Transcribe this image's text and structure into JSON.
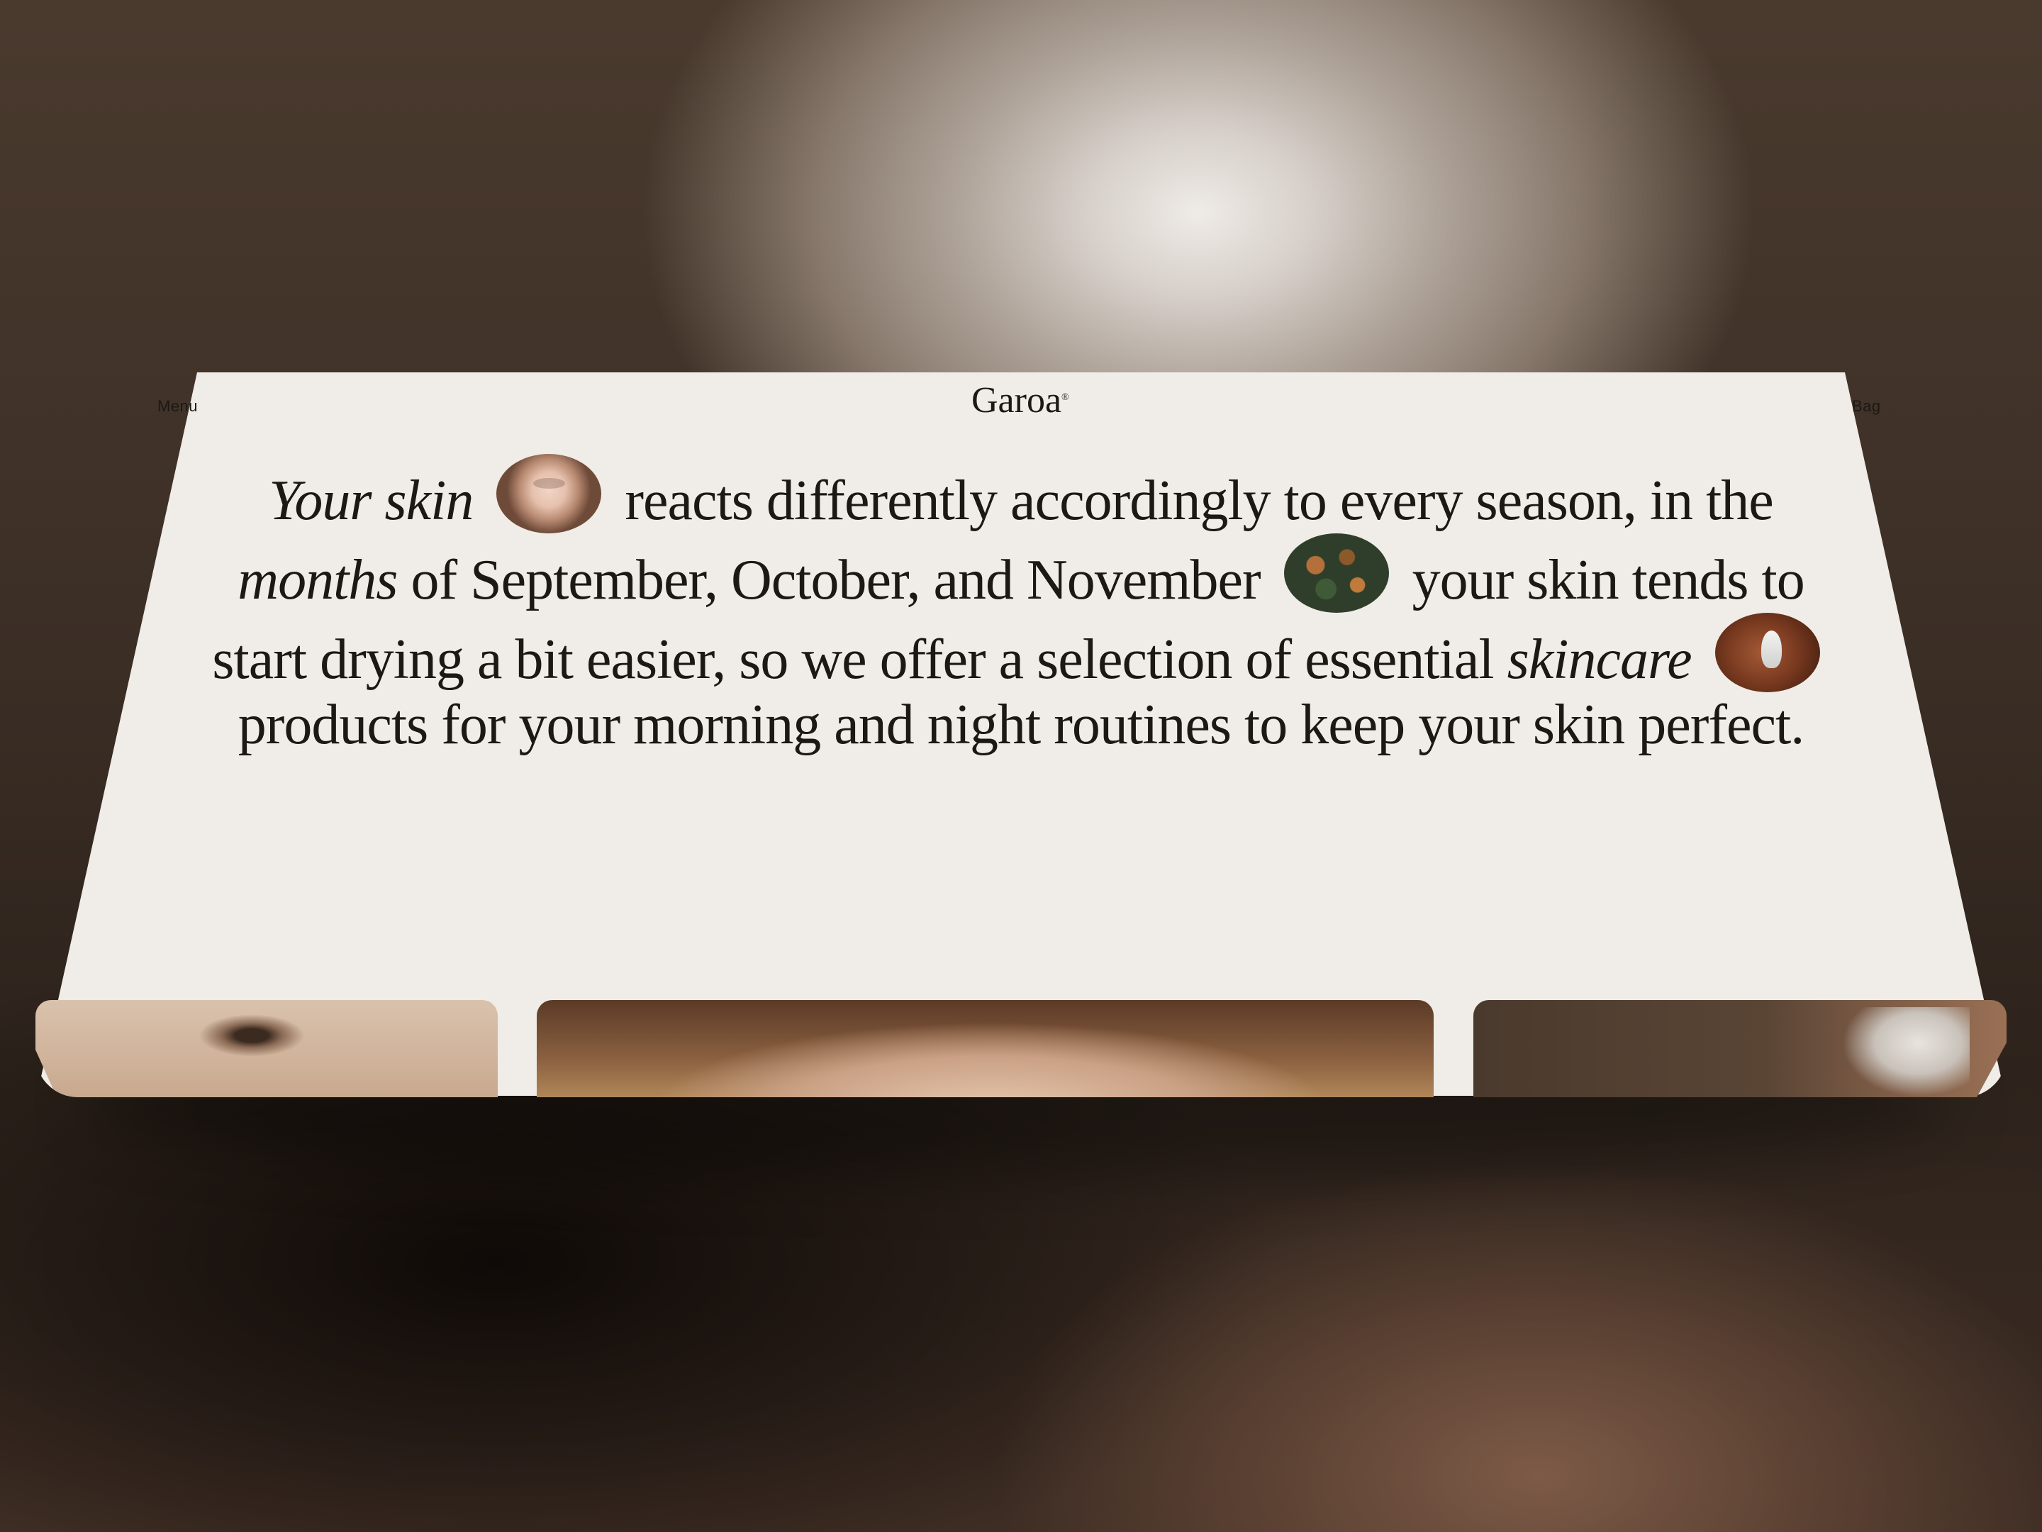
{
  "header": {
    "menu_label": "Menu",
    "brand_name": "Garoa",
    "brand_mark": "®",
    "bag_label": "Bag"
  },
  "intro": {
    "part1": "Your skin",
    "part2": "reacts differently accordingly to every season, in the",
    "part3": "months",
    "part4": "of September, October, and November",
    "part5": "your skin tends to start drying a bit easier, so we offer a selection of essential",
    "part6": "skincare",
    "part7": "products for your morning and night routines to keep your skin perfect."
  },
  "images": {
    "thumb1": "face-with-hands-photo",
    "thumb2": "autumn-leaves-photo",
    "thumb3": "hand-with-product-photo"
  },
  "cards": [
    "model-eye-photo",
    "model-forehead-photo",
    "model-face-mask-photo"
  ]
}
